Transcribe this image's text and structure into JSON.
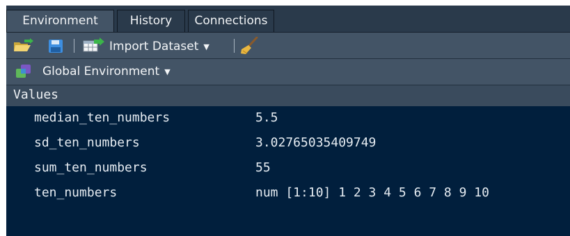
{
  "tabs": [
    {
      "label": "Environment"
    },
    {
      "label": "History"
    },
    {
      "label": "Connections"
    }
  ],
  "toolbar": {
    "open_icon": "folder-open-icon",
    "save_icon": "floppy-disk-icon",
    "import_icon": "import-dataset-icon",
    "import_label": "Import Dataset",
    "clear_icon": "broom-icon"
  },
  "env": {
    "icon": "global-env-icon",
    "label": "Global Environment"
  },
  "section": {
    "header": "Values"
  },
  "values": [
    {
      "name": "median_ten_numbers",
      "value": "5.5"
    },
    {
      "name": "sd_ten_numbers",
      "value": "3.02765035409749"
    },
    {
      "name": "sum_ten_numbers",
      "value": "55"
    },
    {
      "name": "ten_numbers",
      "value": "num [1:10] 1 2 3 4 5 6 7 8 9 10"
    }
  ]
}
